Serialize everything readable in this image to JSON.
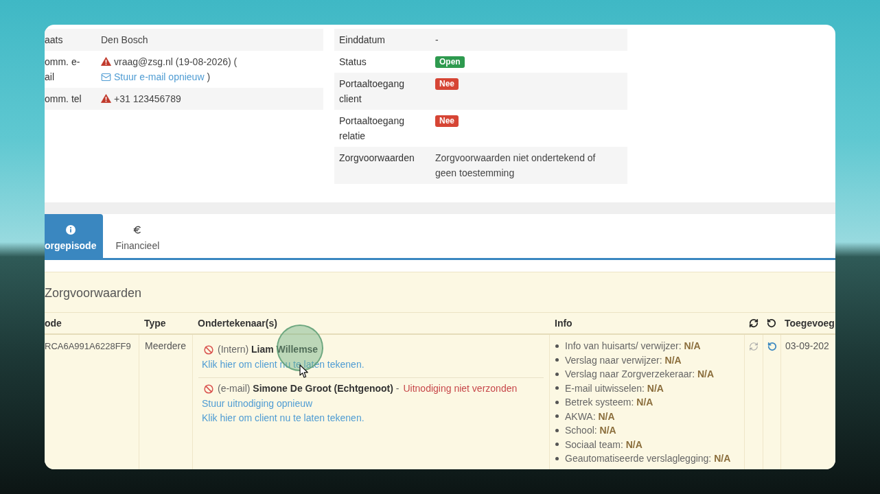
{
  "contact_details": [
    {
      "label": "aats",
      "kind": "text",
      "warning": false,
      "value": "Den Bosch"
    },
    {
      "label": "omm. e-\nail",
      "kind": "email",
      "warning": true,
      "value": "vraag@zsg.nl (19-08-2026) (",
      "link": "Stuur e-mail opnieuw",
      "after": ")"
    },
    {
      "label": "omm. tel",
      "kind": "text",
      "warning": true,
      "value": "+31 123456789"
    }
  ],
  "episode_details": [
    {
      "label": "Einddatum",
      "kind": "text",
      "value": "-"
    },
    {
      "label": "Status",
      "kind": "badge",
      "value": "Open",
      "color": "#2e9a4f"
    },
    {
      "label": "Portaaltoegang client",
      "kind": "badge",
      "value": "Nee",
      "color": "#d64535"
    },
    {
      "label": "Portaaltoegang relatie",
      "kind": "badge",
      "value": "Nee",
      "color": "#d64535"
    },
    {
      "label": "Zorgvoorwaarden",
      "kind": "text",
      "value": "Zorgvoorwaarden niet ondertekend of geen toestemming"
    }
  ],
  "tabs": [
    {
      "label": "orgepisode",
      "selected": true
    },
    {
      "label": "Financieel",
      "selected": false
    }
  ],
  "conditions": {
    "title": "Zorgvoorwaarden",
    "columns": [
      {
        "kind": "text",
        "label": "ode"
      },
      {
        "kind": "text",
        "label": "Type"
      },
      {
        "kind": "text",
        "label": "Ondertekenaar(s)"
      },
      {
        "kind": "text",
        "label": "Info"
      },
      {
        "kind": "icon"
      },
      {
        "kind": "icon"
      },
      {
        "kind": "text",
        "label": "Toegevoeg"
      }
    ],
    "rows": [
      {
        "code": "RCA6A991A6228FF9",
        "type": "Meerdere",
        "signers": [
          {
            "signed": false,
            "label": "(Intern) **Liam Willemse**",
            "links": [
              "Klik hier om client nu te laten tekenen."
            ]
          },
          {
            "signed": false,
            "label": "(e-mail) **Simone De Groot (Echtgenoot)** -",
            "status": "Uitnodiging niet verzonden",
            "links": [
              "Stuur uitnodiging opnieuw",
              "Klik hier om client nu te laten tekenen."
            ]
          }
        ],
        "info": [
          "Info van huisarts/ verwijzer: **N/A**",
          "Verslag naar verwijzer: **N/A**",
          "Verslag naar Zorgverzekeraar: **N/A**",
          "E-mail uitwisselen: **N/A**",
          "Betrek systeem: **N/A**",
          "AKWA: **N/A**",
          "School: **N/A**",
          "Sociaal team: **N/A**",
          "Geautomatiseerde verslaglegging: **N/A**"
        ],
        "added": "03-09-202"
      }
    ]
  }
}
